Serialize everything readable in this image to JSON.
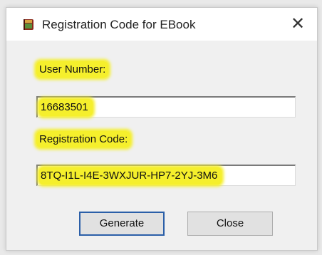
{
  "window": {
    "title": "Registration Code for EBook",
    "close_glyph": "✕",
    "icon": "ebook-app-icon"
  },
  "form": {
    "user_number_label": "User Number:",
    "user_number_value": "16683501",
    "registration_code_label": "Registration Code:",
    "registration_code_value": "8TQ-I1L-I4E-3WXJUR-HP7-2YJ-3M6"
  },
  "buttons": {
    "generate_label": "Generate",
    "close_label": "Close"
  },
  "colors": {
    "highlight": "#f5ef2c",
    "default_button_border": "#2b5fa8"
  }
}
